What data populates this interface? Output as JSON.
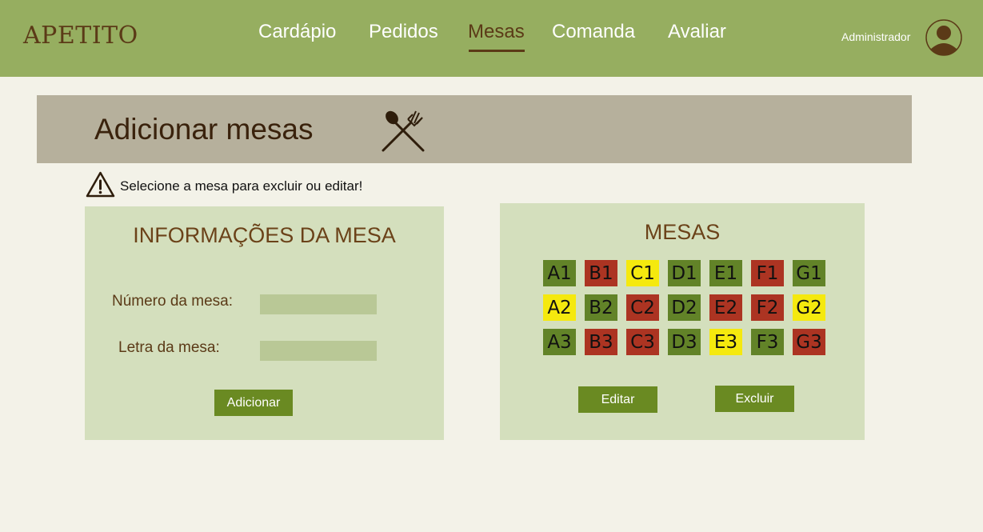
{
  "app": {
    "logo": "APETITO"
  },
  "nav": {
    "items": [
      {
        "label": "Cardápio"
      },
      {
        "label": "Pedidos"
      },
      {
        "label": "Mesas"
      },
      {
        "label": "Comanda"
      },
      {
        "label": "Avaliar"
      }
    ],
    "active": "Mesas"
  },
  "user": {
    "name": "Administrador",
    "avatar_icon": "user-avatar-icon"
  },
  "banner": {
    "title": "Adicionar mesas",
    "icon": "cutlery-icon"
  },
  "warning": {
    "text": "Selecione a mesa para excluir ou editar!",
    "icon": "warning-icon"
  },
  "info_panel": {
    "title": "INFORMAÇÕES DA MESA",
    "number_label": "Número da mesa:",
    "number_value": "",
    "letter_label": "Letra da mesa:",
    "letter_value": "",
    "add_button": "Adicionar"
  },
  "tables_panel": {
    "title": "MESAS",
    "edit_button": "Editar",
    "delete_button": "Excluir",
    "status_colors": {
      "green": "#628328",
      "red": "#ac3422",
      "yellow": "#f5e90e"
    },
    "tables": [
      {
        "label": "A1",
        "status": "green"
      },
      {
        "label": "B1",
        "status": "red"
      },
      {
        "label": "C1",
        "status": "yellow"
      },
      {
        "label": "D1",
        "status": "green"
      },
      {
        "label": "E1",
        "status": "green"
      },
      {
        "label": "F1",
        "status": "red"
      },
      {
        "label": "G1",
        "status": "green"
      },
      {
        "label": "A2",
        "status": "yellow"
      },
      {
        "label": "B2",
        "status": "green"
      },
      {
        "label": "C2",
        "status": "red"
      },
      {
        "label": "D2",
        "status": "green"
      },
      {
        "label": "E2",
        "status": "red"
      },
      {
        "label": "F2",
        "status": "red"
      },
      {
        "label": "G2",
        "status": "yellow"
      },
      {
        "label": "A3",
        "status": "green"
      },
      {
        "label": "B3",
        "status": "red"
      },
      {
        "label": "C3",
        "status": "red"
      },
      {
        "label": "D3",
        "status": "green"
      },
      {
        "label": "E3",
        "status": "yellow"
      },
      {
        "label": "F3",
        "status": "green"
      },
      {
        "label": "G3",
        "status": "red"
      }
    ]
  },
  "colors": {
    "header_bg": "#96ae60",
    "page_bg": "#f3f2e8",
    "banner_bg": "#b6b09c",
    "panel_bg": "#d4dfbd",
    "input_bg": "#b9c896",
    "button_bg": "#6a8a22",
    "brown_text": "#5b3a17"
  }
}
